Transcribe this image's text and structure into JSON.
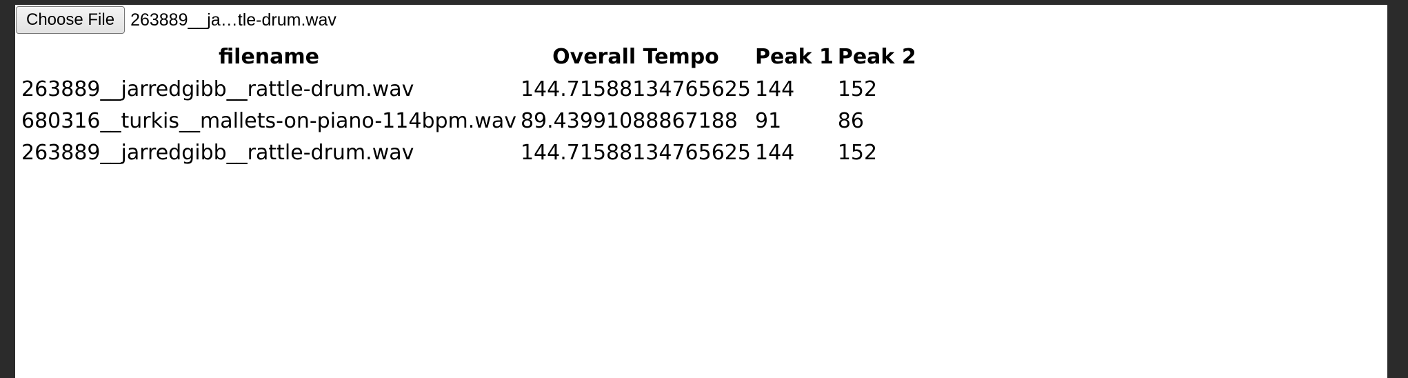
{
  "file_input": {
    "button_label": "Choose File",
    "selected_file": "263889__ja…tle-drum.wav"
  },
  "table": {
    "headers": [
      "filename",
      "Overall Tempo",
      "Peak 1",
      "Peak 2"
    ],
    "rows": [
      [
        "263889__jarredgibb__rattle-drum.wav",
        "144.71588134765625",
        "144",
        "152"
      ],
      [
        "680316__turkis__mallets-on-piano-114bpm.wav",
        "89.43991088867188",
        "91",
        "86"
      ],
      [
        "263889__jarredgibb__rattle-drum.wav",
        "144.71588134765625",
        "144",
        "152"
      ]
    ]
  }
}
